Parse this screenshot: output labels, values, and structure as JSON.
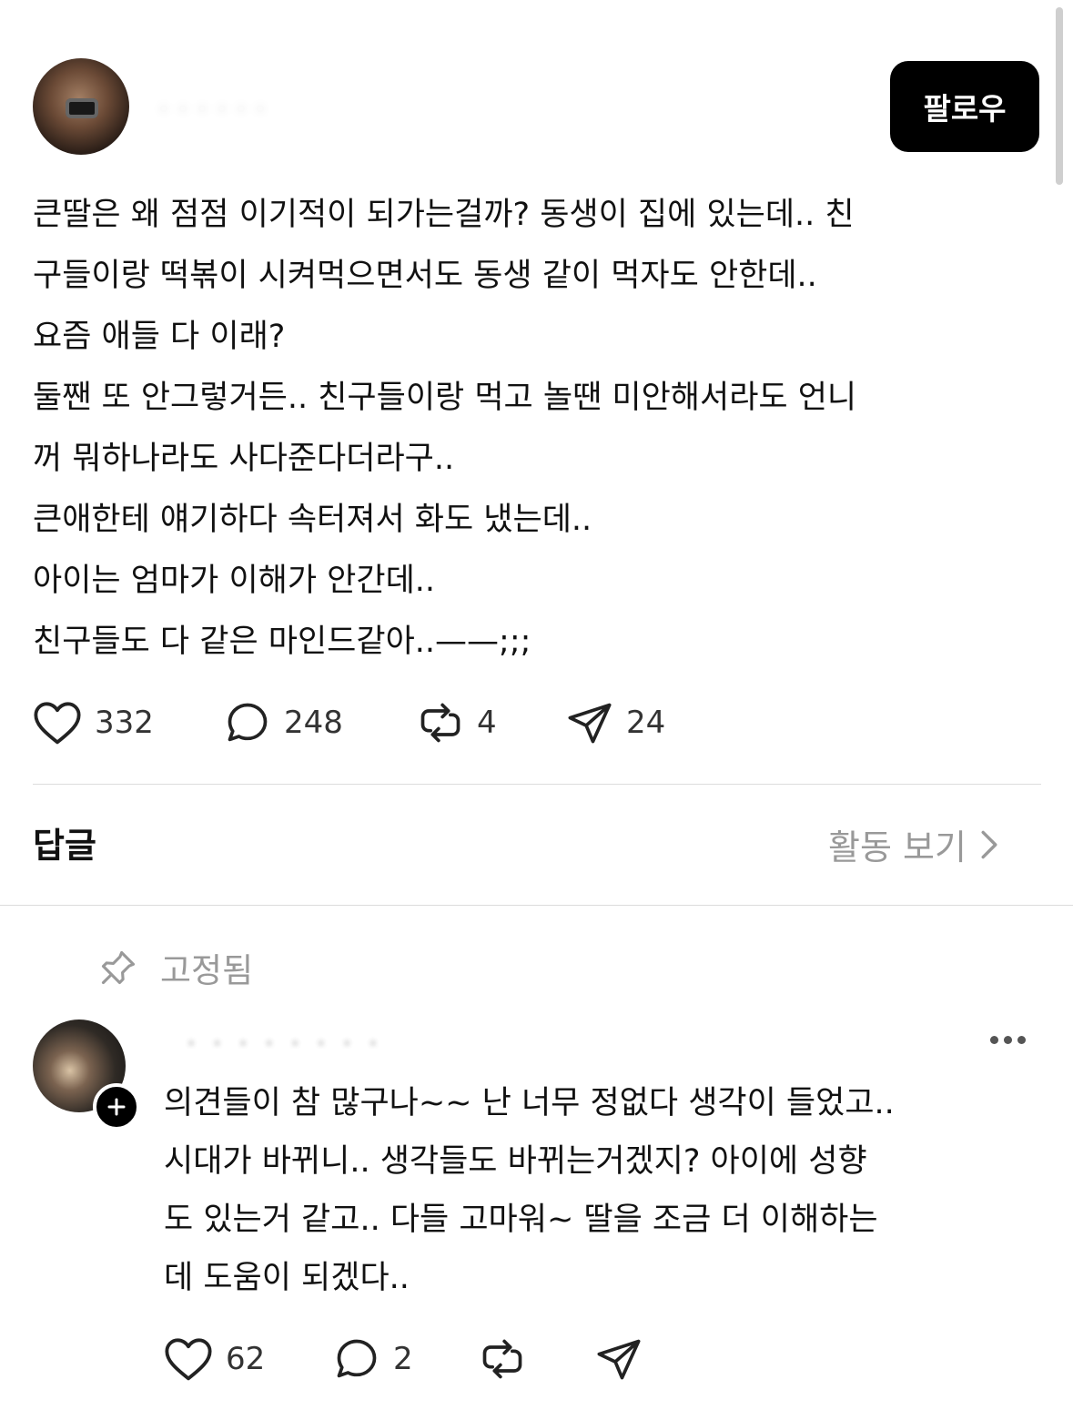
{
  "post": {
    "author": {
      "username_blurred": "· · · · · ·"
    },
    "follow_label": "팔로우",
    "body_lines": [
      "큰딸은 왜 점점 이기적이 되가는걸까? 동생이 집에 있는데.. 친",
      "구들이랑 떡볶이 시켜먹으면서도 동생 같이 먹자도 안한데..",
      "요즘 애들 다 이래?",
      "둘짼 또 안그렇거든.. 친구들이랑 먹고 놀땐 미안해서라도 언니",
      "꺼 뭐하나라도 사다준다더라구..",
      "큰애한테 얘기하다 속터져서 화도 냈는데..",
      "아이는 엄마가 이해가 안간데..",
      "친구들도 다 같은 마인드같아..——;;;"
    ],
    "stats": {
      "likes": "332",
      "comments": "248",
      "reposts": "4",
      "shares": "24"
    }
  },
  "replies_section": {
    "title": "답글",
    "activity_label": "활동 보기"
  },
  "pinned_reply": {
    "pinned_label": "고정됨",
    "author": {
      "username_blurred": "· · · · · · · ·"
    },
    "body_lines": [
      "의견들이 참 많구나~~ 난 너무 정없다 생각이 들었고..",
      "시대가 바뀌니.. 생각들도 바뀌는거겠지? 아이에 성향",
      "도 있는거 같고.. 다들 고마워~  딸을 조금 더 이해하는",
      "데 도움이 되겠다.."
    ],
    "stats": {
      "likes": "62",
      "comments": "2"
    }
  },
  "icons": {
    "like": "heart-icon",
    "comment": "comment-bubble-icon",
    "repost": "repost-icon",
    "share": "send-icon",
    "pin": "pin-icon",
    "more": "more-dots-icon",
    "chevron": "chevron-right-icon",
    "follow_badge": "plus-icon"
  }
}
